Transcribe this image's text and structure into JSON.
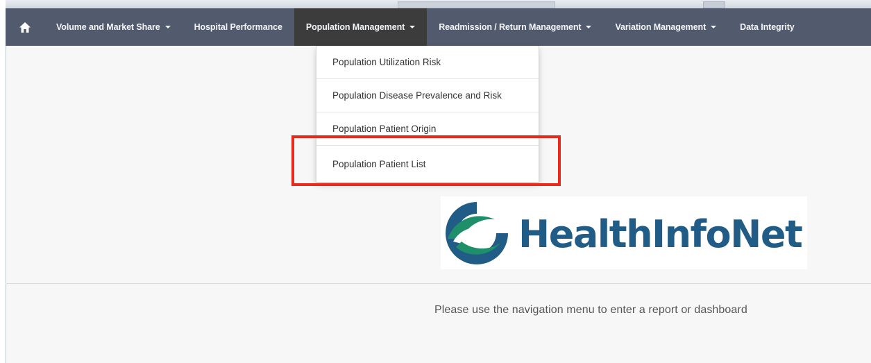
{
  "navbar": {
    "home_icon": "home-icon",
    "items": [
      {
        "label": "Volume and Market Share",
        "has_dropdown": true
      },
      {
        "label": "Hospital Performance",
        "has_dropdown": false
      },
      {
        "label": "Population Management",
        "has_dropdown": true,
        "active": true
      },
      {
        "label": "Readmission / Return Management",
        "has_dropdown": true
      },
      {
        "label": "Variation Management",
        "has_dropdown": true
      },
      {
        "label": "Data Integrity",
        "has_dropdown": false
      }
    ]
  },
  "dropdown": {
    "items": [
      {
        "label": "Population Utilization Risk"
      },
      {
        "label": "Population Disease Prevalence and Risk"
      },
      {
        "label": "Population Patient Origin"
      },
      {
        "label": "Population Patient List",
        "highlighted": true
      }
    ]
  },
  "logo": {
    "text": "HealthInfoNet"
  },
  "main": {
    "hint": "Please use the navigation menu to enter a report or dashboard"
  },
  "colors": {
    "navbar_bg": "#525a6d",
    "navbar_active_bg": "#3c3c3c",
    "highlight": "#e8291c",
    "logo_blue": "#215c87",
    "logo_green": "#1f8f6a"
  }
}
